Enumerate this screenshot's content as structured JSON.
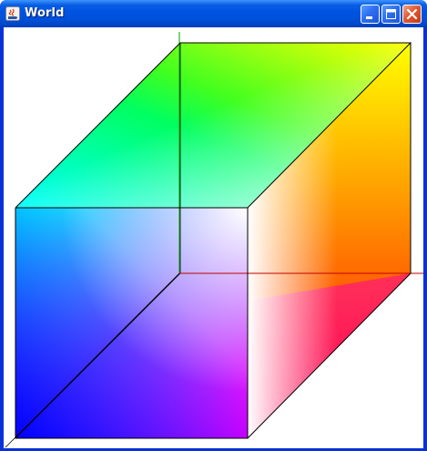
{
  "window": {
    "title": "World",
    "controls": {
      "minimize": "minimize",
      "maximize": "maximize",
      "close": "close"
    }
  },
  "scene": {
    "type": "rgb-color-cube",
    "colors": {
      "black": "#000000",
      "red": "#ff0000",
      "green": "#00ff00",
      "blue": "#0000ff",
      "yellow": "#ffff00",
      "cyan": "#00ffff",
      "magenta": "#ff00ff",
      "white": "#ffffff"
    },
    "axes": {
      "x_color": "#c00000",
      "y_color": "#00a000"
    }
  }
}
